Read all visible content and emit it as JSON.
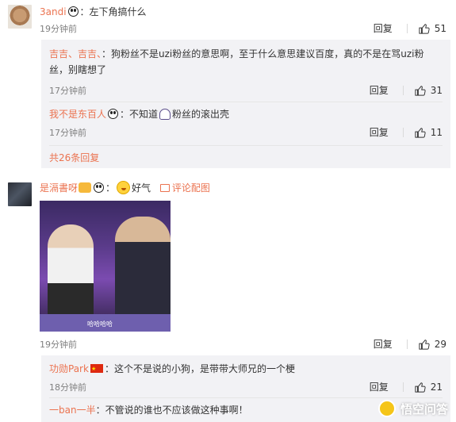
{
  "comments": [
    {
      "username": "3andi",
      "text": "：左下角搞什么",
      "time": "19分钟前",
      "reply_label": "回复",
      "likes": "51",
      "replies": [
        {
          "username": "吉吉、吉吉、",
          "text": "：狗粉丝不是uzi粉丝的意思啊，至于什么意思建议百度，真的不是在骂uzi粉丝，别瞎想了",
          "time": "17分钟前",
          "reply_label": "回复",
          "likes": "31"
        },
        {
          "username": "我不是东百人",
          "text": "：不知道",
          "text2": "粉丝的滚出壳",
          "time": "17分钟前",
          "reply_label": "回复",
          "likes": "11"
        }
      ],
      "more_replies": "共26条回复"
    },
    {
      "username": "是滆書呀",
      "text": "好气",
      "pic_link": "评论配图",
      "time": "19分钟前",
      "reply_label": "回复",
      "likes": "29",
      "photo_text": "哈哈哈哈",
      "replies": [
        {
          "username": "功勋Park",
          "text": "：这个不是说的小狗，是带带大师兄的一个梗",
          "time": "18分钟前",
          "reply_label": "回复",
          "likes": "21"
        },
        {
          "username": "一ban一半",
          "text": "：不管说的谁也不应该做这种事啊！"
        }
      ]
    }
  ],
  "watermark": "悟空问答",
  "icons": [
    "panda-emoji",
    "thumb-up-icon",
    "picture-icon",
    "china-flag",
    "grin-emoji",
    "ghost-emoji",
    "crown-emoji"
  ]
}
